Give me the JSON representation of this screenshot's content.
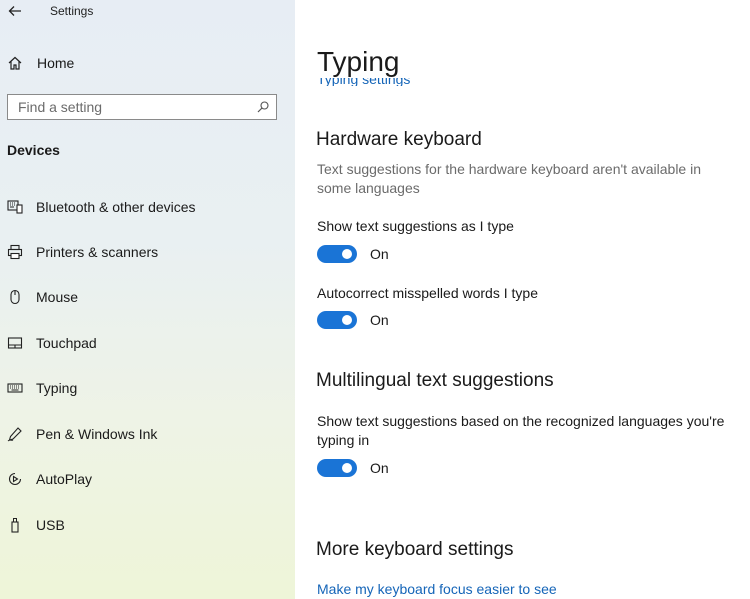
{
  "window": {
    "title": "Settings"
  },
  "sidebar": {
    "home_label": "Home",
    "search_placeholder": "Find a setting",
    "section_header": "Devices",
    "items": [
      {
        "label": "Bluetooth & other devices",
        "icon": "bluetooth-devices-icon"
      },
      {
        "label": "Printers & scanners",
        "icon": "printer-icon"
      },
      {
        "label": "Mouse",
        "icon": "mouse-icon"
      },
      {
        "label": "Touchpad",
        "icon": "touchpad-icon"
      },
      {
        "label": "Typing",
        "icon": "keyboard-icon"
      },
      {
        "label": "Pen & Windows Ink",
        "icon": "pen-icon"
      },
      {
        "label": "AutoPlay",
        "icon": "autoplay-icon"
      },
      {
        "label": "USB",
        "icon": "usb-icon"
      }
    ]
  },
  "main": {
    "page_title": "Typing",
    "clipped_link": "Typing settings",
    "hardware_keyboard": {
      "heading": "Hardware keyboard",
      "description": "Text suggestions for the hardware keyboard aren't available in some languages",
      "show_suggestions": {
        "label": "Show text suggestions as I type",
        "state": "On"
      },
      "autocorrect": {
        "label": "Autocorrect misspelled words I type",
        "state": "On"
      }
    },
    "multilingual": {
      "heading": "Multilingual text suggestions",
      "show_suggestions": {
        "label": "Show text suggestions based on the recognized languages you're typing in",
        "state": "On"
      }
    },
    "more_keyboard": {
      "heading": "More keyboard settings",
      "link": "Make my keyboard focus easier to see"
    }
  },
  "colors": {
    "accent": "#1a74d6",
    "link": "#1565b8",
    "secondary_text": "#6b6b6b"
  }
}
